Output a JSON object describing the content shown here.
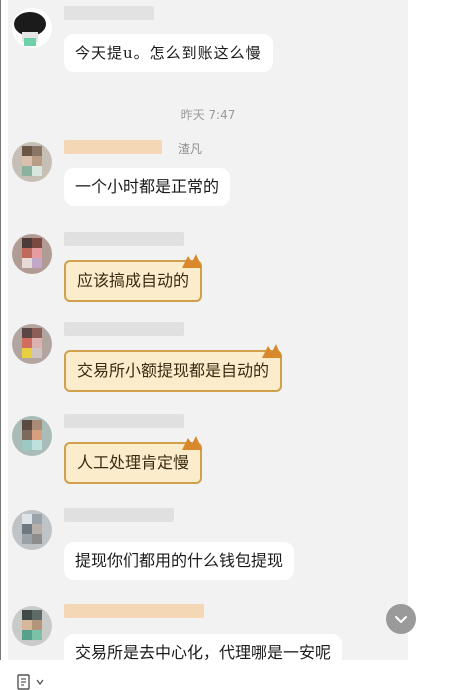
{
  "messages": [
    {
      "id": "m1",
      "text": "今天提u。怎么到账这么慢",
      "style": "handwritten"
    },
    {
      "id": "ts",
      "text": "昨天 7:47"
    },
    {
      "id": "m2",
      "sender_fragment": "渣凡",
      "text": "一个小时都是正常的",
      "style": "normal"
    },
    {
      "id": "m3",
      "text": "应该搞成自动的",
      "style": "sticker"
    },
    {
      "id": "m4",
      "text": "交易所小额提现都是自动的",
      "style": "sticker"
    },
    {
      "id": "m5",
      "text": "人工处理肯定慢",
      "style": "sticker"
    },
    {
      "id": "m6",
      "text": "提现你们都用的什么钱包提现",
      "style": "normal"
    },
    {
      "id": "m7",
      "text": "交易所是去中心化，代理哪是一安呢",
      "style": "normal_cut"
    }
  ],
  "icons": {
    "scroll_down": "chevron-down-icon",
    "toolbar": "document-tool-icon",
    "toolbar_caret": "caret-down-icon"
  },
  "colors": {
    "chat_bg": "#f2f2f2",
    "bubble_bg": "#ffffff",
    "sticker_bg": "#fbeccb",
    "sticker_border": "#d1a04c",
    "timestamp": "#9a9a9a"
  }
}
